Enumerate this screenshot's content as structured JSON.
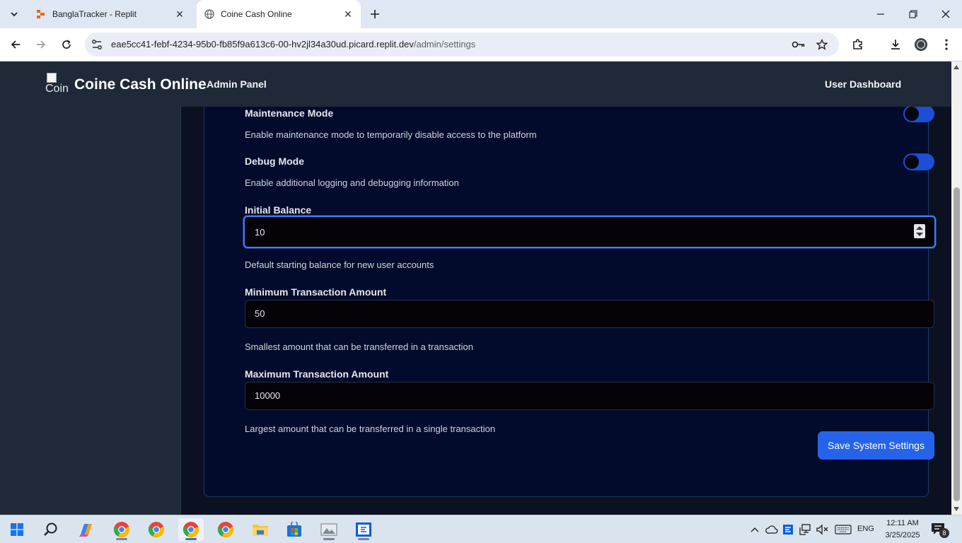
{
  "browser": {
    "tabs": [
      {
        "title": "BanglaTracker - Replit",
        "active": false
      },
      {
        "title": "Coine Cash Online",
        "active": true
      }
    ],
    "url_host": "eae5cc41-febf-4234-95b0-fb85f9a613c6-00-hv2jl34a30ud.picard.replit.dev",
    "url_path": "/admin/settings"
  },
  "header": {
    "logo_alt": "Coin",
    "brand": "Coine Cash Online",
    "nav_admin": "Admin Panel",
    "nav_user": "User Dashboard"
  },
  "settings": {
    "maintenance": {
      "title": "Maintenance Mode",
      "desc": "Enable maintenance mode to temporarily disable access to the platform",
      "enabled": false
    },
    "debug": {
      "title": "Debug Mode",
      "desc": "Enable additional logging and debugging information",
      "enabled": false
    },
    "initial_balance": {
      "label": "Initial Balance",
      "value": "10",
      "desc": "Default starting balance for new user accounts"
    },
    "min_tx": {
      "label": "Minimum Transaction Amount",
      "value": "50",
      "desc": "Smallest amount that can be transferred in a transaction"
    },
    "max_tx": {
      "label": "Maximum Transaction Amount",
      "value": "10000",
      "desc": "Largest amount that can be transferred in a single transaction"
    },
    "save_label": "Save System Settings"
  },
  "taskbar": {
    "language": "ENG",
    "time": "12:11 AM",
    "date": "3/25/2025",
    "notification_count": "8"
  },
  "colors": {
    "accent": "#2563eb",
    "toggle_track": "#1d4ed8",
    "header_bg": "#1f2937",
    "card_bg": "#020b2b"
  }
}
